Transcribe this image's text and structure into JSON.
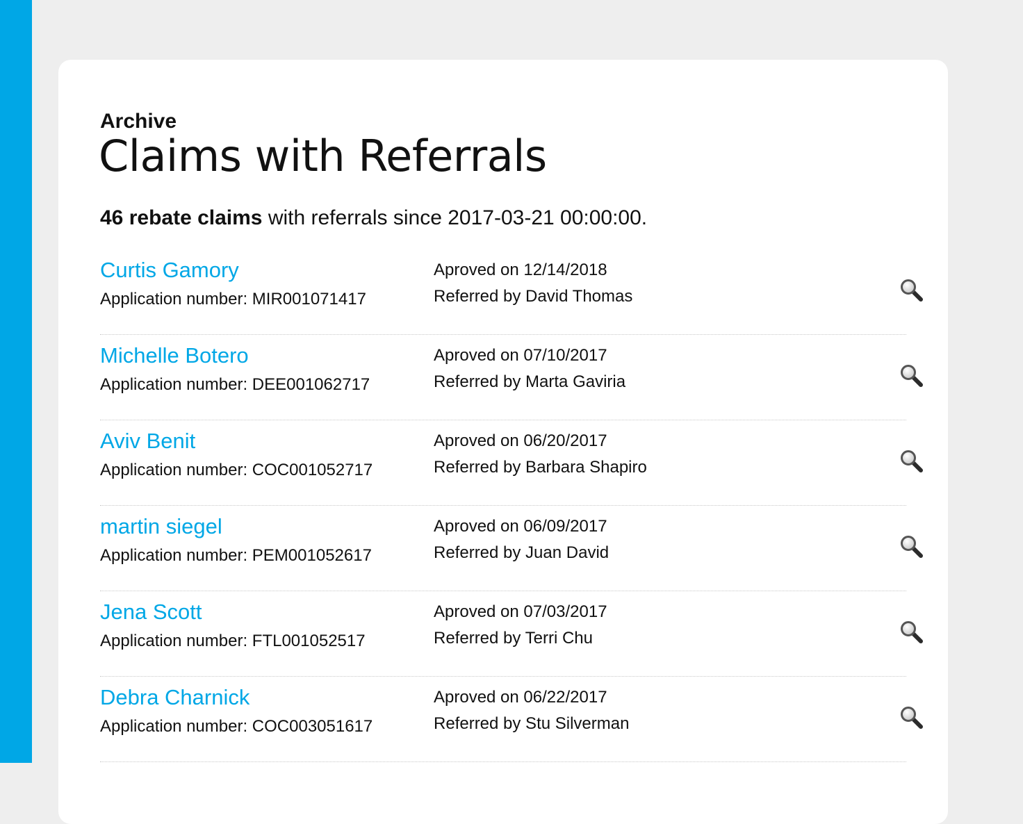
{
  "header": {
    "eyebrow": "Archive",
    "title": "Claims with Referrals"
  },
  "summary": {
    "count_text": "46 rebate claims",
    "rest_text": " with referrals since 2017-03-21 00:00:00."
  },
  "colors": {
    "accent": "#00a7e6",
    "background": "#eeeeee",
    "card": "#ffffff"
  },
  "claims": [
    {
      "name": "Curtis Gamory",
      "application": "Application number: MIR001071417",
      "approved": "Aproved on 12/14/2018",
      "referred": "Referred by David Thomas",
      "icon": "magnifier-icon"
    },
    {
      "name": "Michelle Botero",
      "application": "Application number: DEE001062717",
      "approved": "Aproved on 07/10/2017",
      "referred": "Referred by Marta Gaviria",
      "icon": "magnifier-icon"
    },
    {
      "name": "Aviv Benit",
      "application": "Application number: COC001052717",
      "approved": "Aproved on 06/20/2017",
      "referred": "Referred by Barbara Shapiro",
      "icon": "magnifier-icon"
    },
    {
      "name": "martin siegel",
      "application": "Application number: PEM001052617",
      "approved": "Aproved on 06/09/2017",
      "referred": "Referred by Juan David",
      "icon": "magnifier-icon"
    },
    {
      "name": "Jena Scott",
      "application": "Application number: FTL001052517",
      "approved": "Aproved on 07/03/2017",
      "referred": "Referred by Terri Chu",
      "icon": "magnifier-icon"
    },
    {
      "name": "Debra Charnick",
      "application": "Application number: COC003051617",
      "approved": "Aproved on 06/22/2017",
      "referred": "Referred by Stu Silverman",
      "icon": "magnifier-icon"
    }
  ]
}
